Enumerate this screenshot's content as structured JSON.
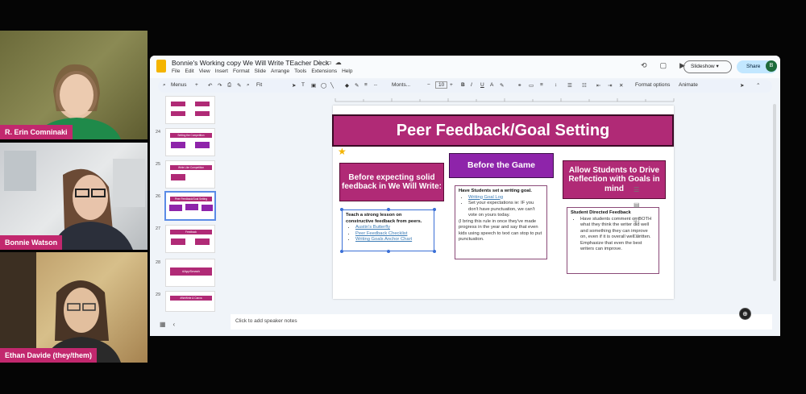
{
  "participants": [
    {
      "name": "R. Erin Comninaki"
    },
    {
      "name": "Bonnie Watson"
    },
    {
      "name": "Ethan Davide (they/them)"
    }
  ],
  "app": {
    "doc_title": "Bonnie's Working copy We Will Write TEacher Deck",
    "menu": [
      "File",
      "Edit",
      "View",
      "Insert",
      "Format",
      "Slide",
      "Arrange",
      "Tools",
      "Extensions",
      "Help"
    ],
    "slideshow_label": "Slideshow",
    "share_label": "Share",
    "avatar_letter": "B",
    "toolbar": {
      "menus": "Menus",
      "fit": "Fit",
      "font": "Monts...",
      "font_size": "10",
      "format_options": "Format options",
      "animate": "Animate"
    }
  },
  "filmstrip": [
    {
      "num": "",
      "label": ""
    },
    {
      "num": "24",
      "label": "Setting the Competition"
    },
    {
      "num": "25",
      "label": "Write Like Competition"
    },
    {
      "num": "26",
      "label": "Peer Feedback/Goal Setting"
    },
    {
      "num": "27",
      "label": "Feedback"
    },
    {
      "num": "28",
      "label": "#AppSmash"
    },
    {
      "num": "29",
      "label": "#WeWrite & Canva"
    }
  ],
  "slide": {
    "title": "Peer Feedback/Goal Setting",
    "col1": {
      "header": "Before expecting solid feedback in We Will Write:",
      "lead": "Teach a strong lesson on constructive feedback from peers.",
      "links": [
        "Austin's Butterfly",
        "Peer Feedback Checklist",
        "Writing Goals Anchor Chart"
      ]
    },
    "col2": {
      "header": "Before the Game",
      "lead": "Have Students set a writing goal.",
      "link": "Writing Goal Log",
      "bullet2": "Set your expectations ie: IF you don't have punctuation, we can't vote on yours today.",
      "after": "(I bring this rule in once they've made progress in the year and say that even kids using speech to text can stop to put punctuation."
    },
    "col3": {
      "header": "Allow Students to Drive Reflection with Goals in mind",
      "lead": "Student Directed Feedback",
      "bullet": "Have students comment on BOTH what they think the writer did well and something they can improve on, even if it is overall well written. Emphasize that even the best writers can improve."
    }
  },
  "notes_placeholder": "Click to add speaker notes",
  "colors": {
    "accent": "#b02a76",
    "purple": "#8e24aa",
    "name_tag": "#c2286e"
  }
}
